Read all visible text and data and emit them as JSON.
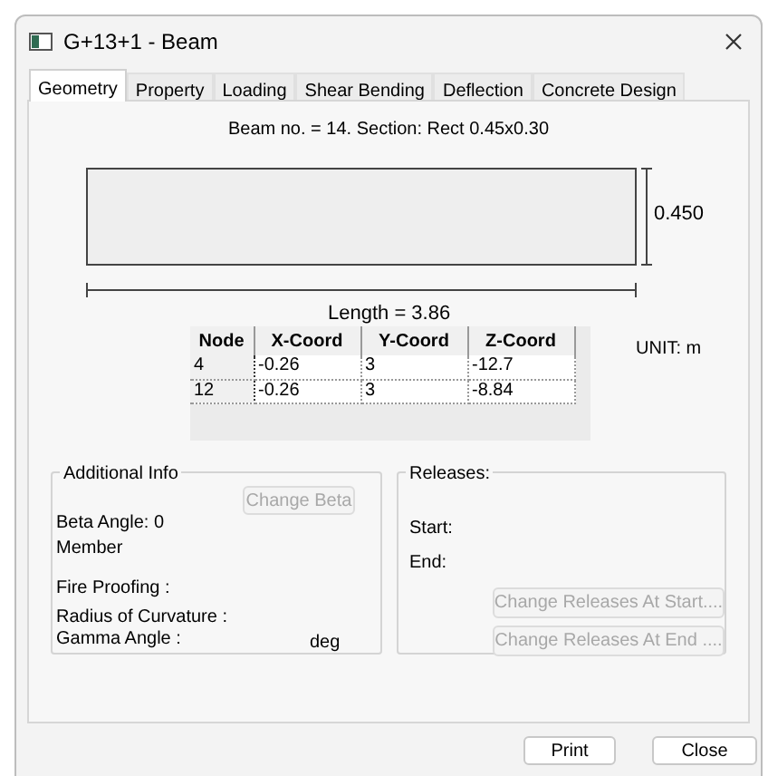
{
  "window": {
    "title": "G+13+1 - Beam"
  },
  "tabs": [
    {
      "label": "Geometry",
      "selected": true
    },
    {
      "label": "Property",
      "selected": false
    },
    {
      "label": "Loading",
      "selected": false
    },
    {
      "label": "Shear Bending",
      "selected": false
    },
    {
      "label": "Deflection",
      "selected": false
    },
    {
      "label": "Concrete Design",
      "selected": false
    }
  ],
  "beam_caption": "Beam no. = 14. Section: Rect 0.45x0.30",
  "drawing": {
    "depth": "0.450",
    "length": "Length = 3.86"
  },
  "table": {
    "columns": [
      "Node",
      "X-Coord",
      "Y-Coord",
      "Z-Coord"
    ],
    "rows": [
      [
        "4",
        "-0.26",
        "3",
        "-12.7"
      ],
      [
        "12",
        "-0.26",
        "3",
        "-8.84"
      ]
    ]
  },
  "unit": "UNIT: m",
  "additional_info": {
    "title": "Additional Info",
    "beta_label": "Beta Angle:",
    "beta_value": "0",
    "member": "Member",
    "fire_proofing": "Fire Proofing :",
    "radius": "Radius of Curvature :",
    "gamma": "Gamma Angle :",
    "gamma_unit": "deg",
    "button": {
      "label": "Change Beta",
      "disabled": true
    }
  },
  "releases": {
    "title": "Releases:",
    "start": "Start:",
    "end": "End:",
    "buttons": [
      {
        "label": "Change Releases At Start....",
        "disabled": true
      },
      {
        "label": "Change Releases At End ....",
        "disabled": true
      }
    ]
  },
  "footer_buttons": [
    {
      "label": "Print",
      "disabled": false
    },
    {
      "label": "Close",
      "disabled": false
    }
  ]
}
